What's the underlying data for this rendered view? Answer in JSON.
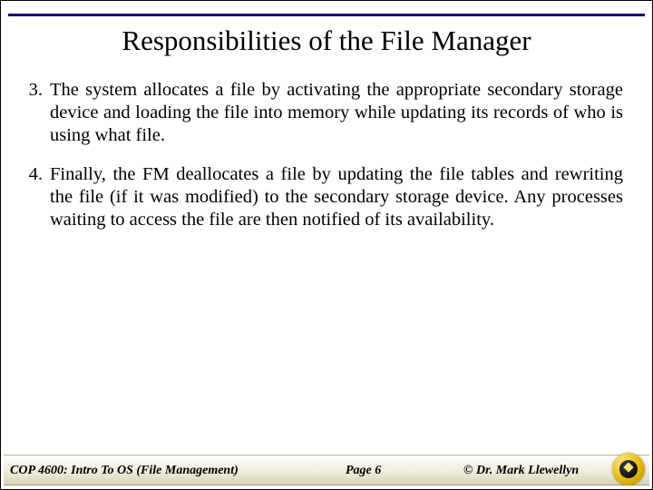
{
  "title": "Responsibilities of the File Manager",
  "items": [
    {
      "n": "3.",
      "text": "The system allocates a file by activating the appropriate secondary storage device and loading the file into memory while updating its records of who is using what file."
    },
    {
      "n": "4.",
      "text": "Finally, the FM deallocates a file by updating the file tables and rewriting the file (if it was modified) to the secondary storage device.  Any processes waiting to access the file are then notified of its availability."
    }
  ],
  "footer": {
    "left": "COP 4600: Intro To OS  (File Management)",
    "mid": "Page 6",
    "right": "© Dr. Mark Llewellyn"
  }
}
